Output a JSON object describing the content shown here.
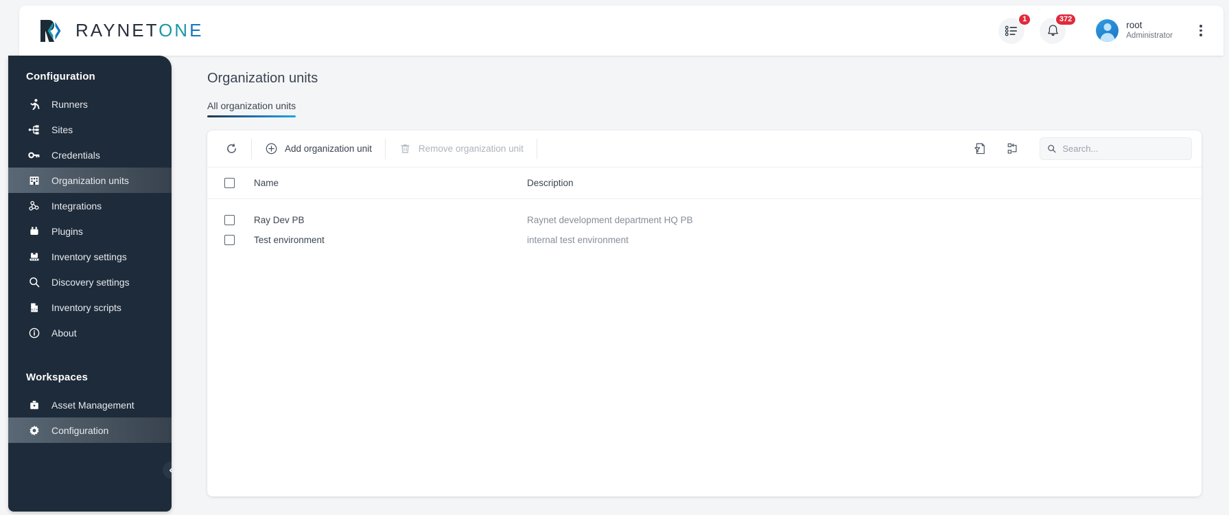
{
  "brand": {
    "logo_text_dark": "RAYNET",
    "logo_text_teal": "ON",
    "logo_text_blue": "E",
    "logo_icon": "raynet-bracket-logo",
    "accent_teal": "#1a98a8",
    "accent_blue": "#1577bd",
    "sidebar_bg": "#1e2b3a",
    "badge_red": "#e02a3c"
  },
  "header": {
    "tasks_icon": "task-list-icon",
    "tasks_badge": "1",
    "notifications_icon": "bell-icon",
    "notifications_badge": "372",
    "avatar_icon": "user-avatar",
    "user_name": "root",
    "user_role": "Administrator",
    "menu_icon": "vertical-dots-icon"
  },
  "sidebar": {
    "sections": [
      {
        "title": "Configuration",
        "items": [
          {
            "label": "Runners",
            "icon": "runner-icon",
            "active": false
          },
          {
            "label": "Sites",
            "icon": "sitemap-icon",
            "active": false
          },
          {
            "label": "Credentials",
            "icon": "key-icon",
            "active": false
          },
          {
            "label": "Organization units",
            "icon": "building-icon",
            "active": true
          },
          {
            "label": "Integrations",
            "icon": "integrations-icon",
            "active": false
          },
          {
            "label": "Plugins",
            "icon": "plug-icon",
            "active": false
          },
          {
            "label": "Inventory settings",
            "icon": "inventory-settings-icon",
            "active": false
          },
          {
            "label": "Discovery settings",
            "icon": "magnifier-icon",
            "active": false
          },
          {
            "label": "Inventory scripts",
            "icon": "script-file-icon",
            "active": false
          },
          {
            "label": "About",
            "icon": "info-circle-icon",
            "active": false
          }
        ]
      },
      {
        "title": "Workspaces",
        "items": [
          {
            "label": "Asset Management",
            "icon": "briefcase-icon",
            "active": false
          },
          {
            "label": "Configuration",
            "icon": "gear-icon",
            "active": true
          }
        ]
      }
    ],
    "collapse_icon": "chevron-left-icon"
  },
  "main": {
    "page_title": "Organization units",
    "tabs": [
      {
        "label": "All organization units",
        "active": true
      }
    ],
    "toolbar": {
      "refresh_icon": "refresh-icon",
      "add_label": "Add organization unit",
      "add_icon": "plus-circle-icon",
      "remove_label": "Remove organization unit",
      "remove_icon": "trash-icon",
      "remove_disabled": true,
      "export_icon": "filter-document-icon",
      "columns_icon": "column-settings-icon",
      "search_icon": "search-icon",
      "search_placeholder": "Search...",
      "search_value": ""
    },
    "table": {
      "select_all_checkbox": "unchecked",
      "columns": [
        "Name",
        "Description"
      ],
      "rows": [
        {
          "checked": false,
          "name": "Ray Dev PB",
          "description": "Raynet development department HQ PB"
        },
        {
          "checked": false,
          "name": "Test environment",
          "description": "internal test environment"
        }
      ]
    }
  }
}
